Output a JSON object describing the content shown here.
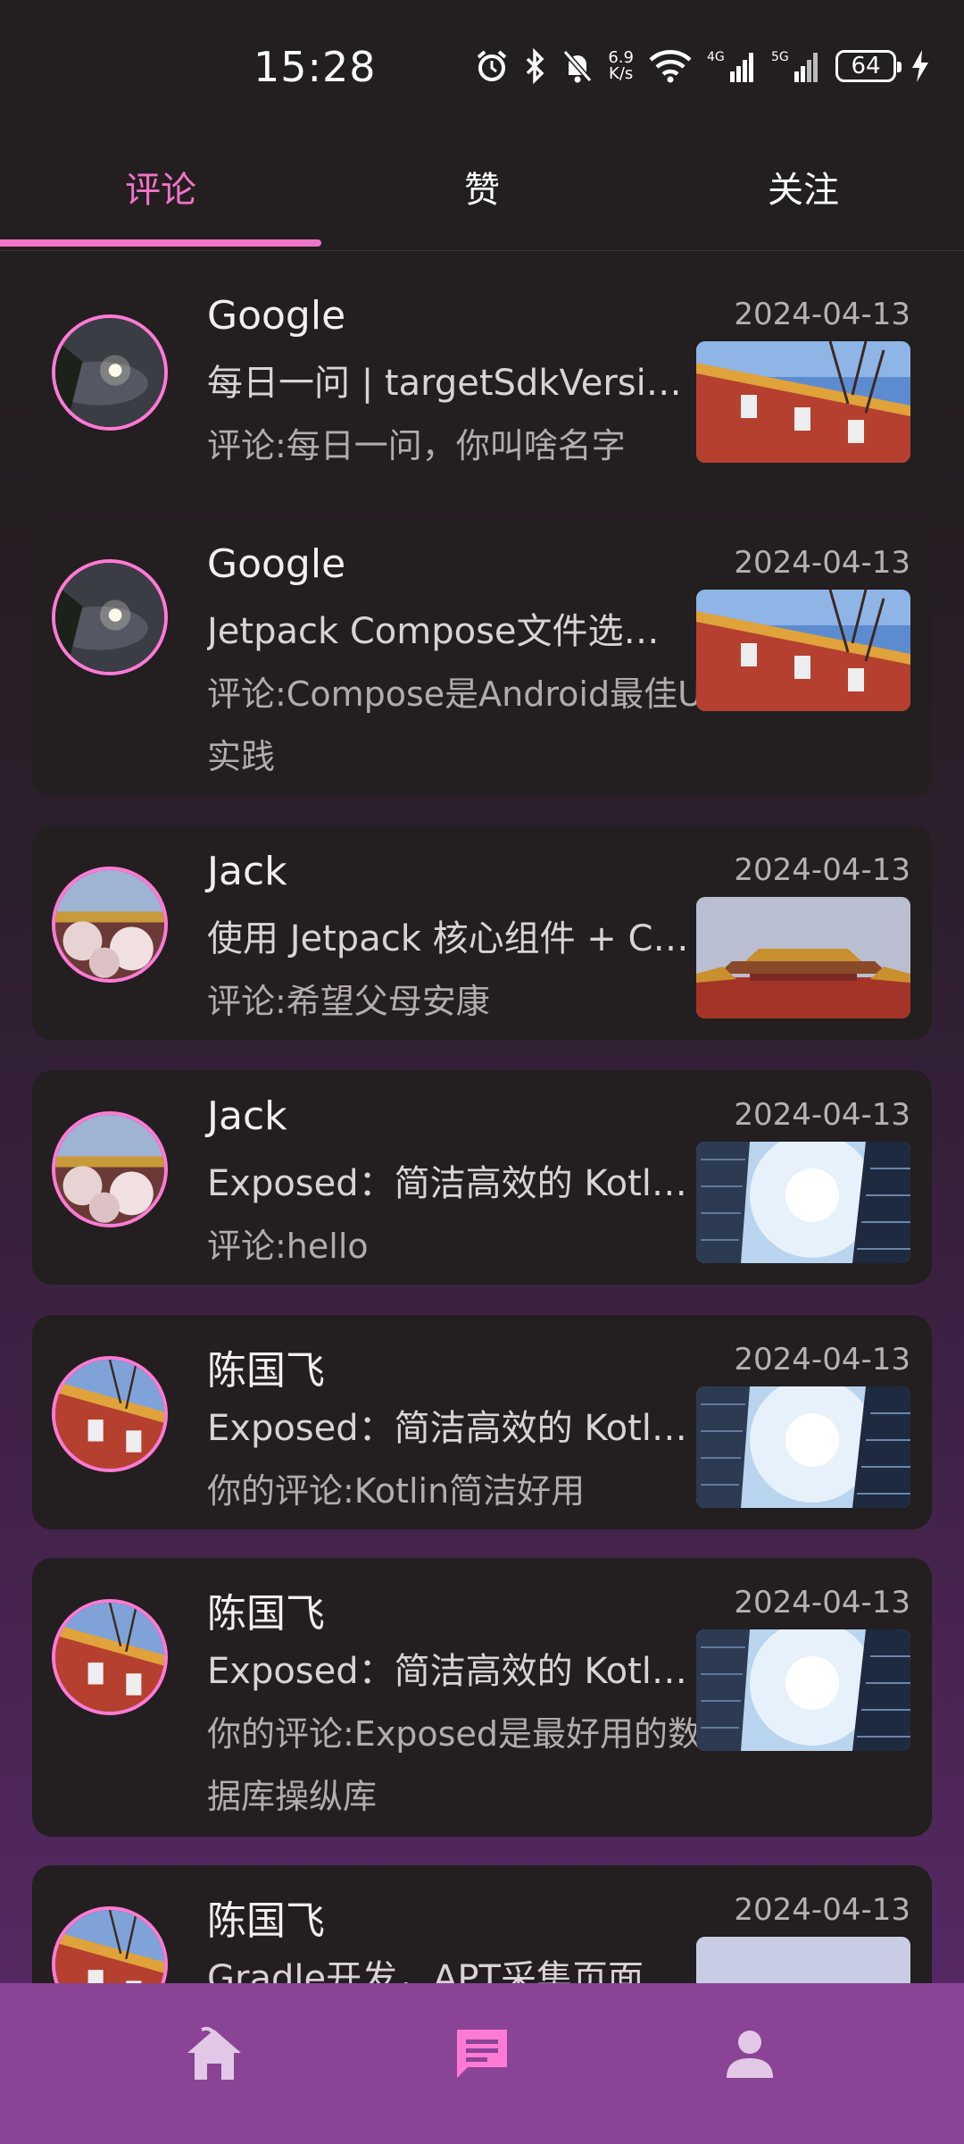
{
  "status_bar": {
    "time": "15:28",
    "net_speed_value": "6.9",
    "net_speed_unit": "K/s",
    "signal_1": "4G",
    "signal_2": "5G",
    "battery": "64",
    "icons": [
      "alarm-icon",
      "bluetooth-icon",
      "mute-icon",
      "wifi-icon",
      "signal-4g-icon",
      "signal-5g-icon",
      "battery-icon",
      "charging-icon"
    ]
  },
  "tabs": [
    {
      "label": "评论",
      "active": true
    },
    {
      "label": "赞",
      "active": false
    },
    {
      "label": "关注",
      "active": false
    }
  ],
  "notifications": [
    {
      "user": "Google",
      "date": "2024-04-13",
      "title": "每日一问 | targetSdkVersion 有什么作用",
      "comment": "评论:每日一问，你叫啥名字",
      "avatar": "moon-night",
      "thumb": "palace-wall"
    },
    {
      "user": "Google",
      "date": "2024-04-13",
      "title": "Jetpack Compose文件选择器实现",
      "comment": "评论:Compose是Android最佳UI实践",
      "avatar": "moon-night",
      "thumb": "palace-wall"
    },
    {
      "user": "Jack",
      "date": "2024-04-13",
      "title": "使用 Jetpack 核心组件 + Compose",
      "comment": "评论:希望父母安康",
      "avatar": "blossom",
      "thumb": "forbidden-city"
    },
    {
      "user": "Jack",
      "date": "2024-04-13",
      "title": "Exposed：简洁高效的 Kotlin ORM",
      "comment": "评论:hello",
      "avatar": "blossom",
      "thumb": "sky-towers"
    },
    {
      "user": "陈国飞",
      "date": "2024-04-13",
      "title": "Exposed：简洁高效的 Kotlin ORM",
      "comment": "你的评论:Kotlin简洁好用",
      "avatar": "palace-wall",
      "thumb": "sky-towers"
    },
    {
      "user": "陈国飞",
      "date": "2024-04-13",
      "title": "Exposed：简洁高效的 Kotlin ORM",
      "comment": "你的评论:Exposed是最好用的数据库操纵库",
      "avatar": "palace-wall",
      "thumb": "sky-towers"
    },
    {
      "user": "陈国飞",
      "date": "2024-04-13",
      "title": "Gradle开发，APT采集页面路由",
      "comment": "",
      "avatar": "palace-wall",
      "thumb": "sky-plain"
    }
  ],
  "bottom_nav": [
    {
      "icon": "home-icon",
      "active": false
    },
    {
      "icon": "message-icon",
      "active": true
    },
    {
      "icon": "profile-icon",
      "active": false
    }
  ],
  "colors": {
    "accent": "#f074c9",
    "background": "#231e1f",
    "nav_bg": "#8a4495"
  }
}
